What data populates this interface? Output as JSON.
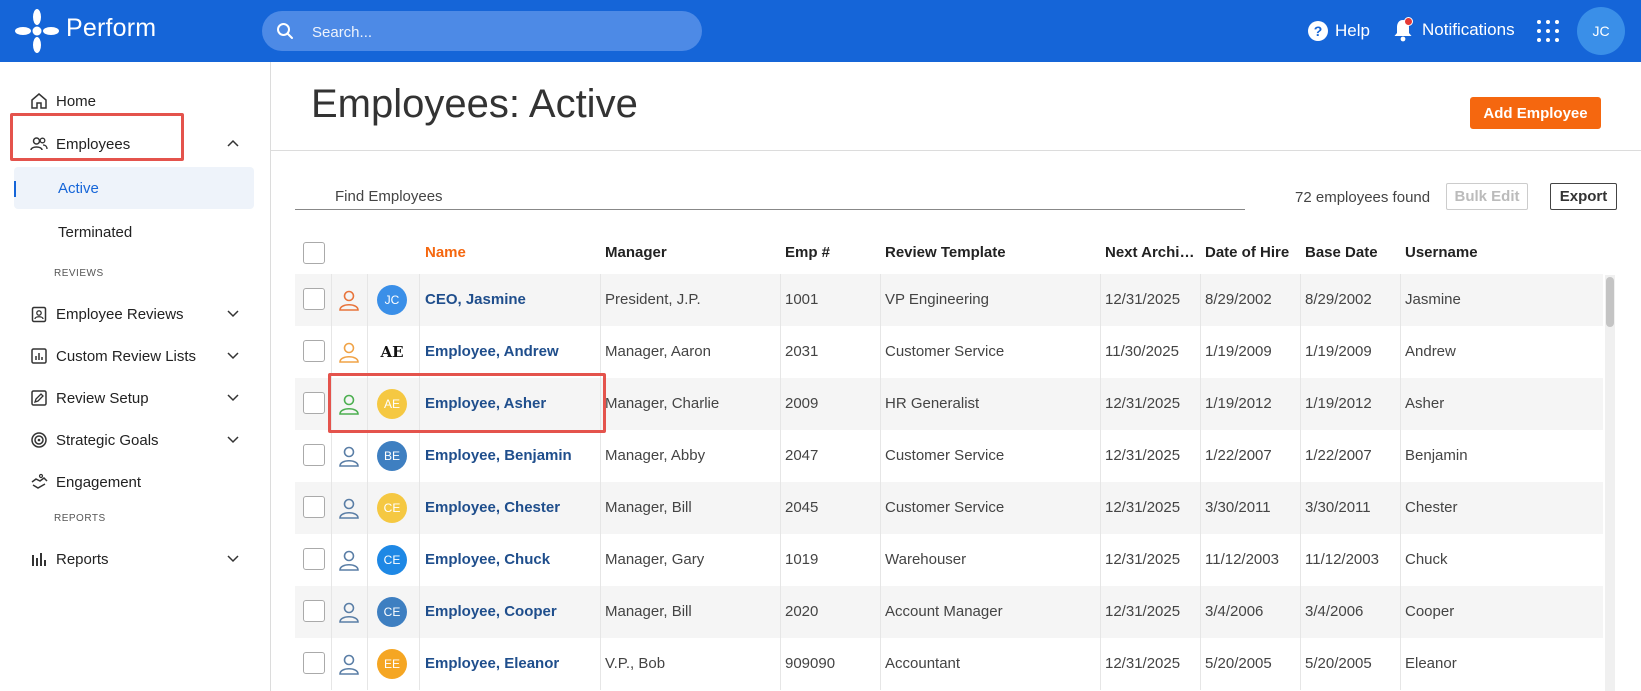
{
  "app": {
    "title": "Perform"
  },
  "header": {
    "search_placeholder": "Search...",
    "help_label": "Help",
    "notifications_label": "Notifications",
    "user_initials": "JC"
  },
  "sidebar": {
    "home": "Home",
    "employees": "Employees",
    "active": "Active",
    "terminated": "Terminated",
    "reviews_section": "REVIEWS",
    "employee_reviews": "Employee Reviews",
    "custom_review_lists": "Custom Review Lists",
    "review_setup": "Review Setup",
    "strategic_goals": "Strategic Goals",
    "engagement": "Engagement",
    "reports_section": "REPORTS",
    "reports": "Reports"
  },
  "main": {
    "title": "Employees: Active",
    "add_button": "Add Employee",
    "find_placeholder": "Find Employees",
    "count_text": "72 employees found",
    "bulk_edit": "Bulk Edit",
    "export": "Export"
  },
  "table": {
    "columns": {
      "name": "Name",
      "manager": "Manager",
      "emp": "Emp #",
      "template": "Review Template",
      "next": "Next Archi…",
      "hire": "Date of Hire",
      "base": "Base Date",
      "username": "Username"
    },
    "rows": [
      {
        "initials": "JC",
        "avatar_color": "#3a8fe8",
        "person_color": "#e8743b",
        "name": "CEO, Jasmine",
        "manager": "President, J.P.",
        "emp": "1001",
        "template": "VP Engineering",
        "next": "12/31/2025",
        "hire": "8/29/2002",
        "base": "8/29/2002",
        "username": "Jasmine"
      },
      {
        "initials": "AE",
        "avatar_color": "logo",
        "person_color": "#f0a347",
        "name": "Employee, Andrew",
        "manager": "Manager, Aaron",
        "emp": "2031",
        "template": "Customer Service",
        "next": "11/30/2025",
        "hire": "1/19/2009",
        "base": "1/19/2009",
        "username": "Andrew"
      },
      {
        "initials": "AE",
        "avatar_color": "#f5c842",
        "person_color": "#4caf50",
        "name": "Employee, Asher",
        "manager": "Manager, Charlie",
        "emp": "2009",
        "template": "HR Generalist",
        "next": "12/31/2025",
        "hire": "1/19/2012",
        "base": "1/19/2012",
        "username": "Asher"
      },
      {
        "initials": "BE",
        "avatar_color": "#3e7fc1",
        "person_color": "#5a7ea6",
        "name": "Employee, Benjamin",
        "manager": "Manager, Abby",
        "emp": "2047",
        "template": "Customer Service",
        "next": "12/31/2025",
        "hire": "1/22/2007",
        "base": "1/22/2007",
        "username": "Benjamin"
      },
      {
        "initials": "CE",
        "avatar_color": "#f5c842",
        "person_color": "#5a7ea6",
        "name": "Employee, Chester",
        "manager": "Manager, Bill",
        "emp": "2045",
        "template": "Customer Service",
        "next": "12/31/2025",
        "hire": "3/30/2011",
        "base": "3/30/2011",
        "username": "Chester"
      },
      {
        "initials": "CE",
        "avatar_color": "#1e88e5",
        "person_color": "#5a7ea6",
        "name": "Employee, Chuck",
        "manager": "Manager, Gary",
        "emp": "1019",
        "template": "Warehouser",
        "next": "12/31/2025",
        "hire": "11/12/2003",
        "base": "11/12/2003",
        "username": "Chuck"
      },
      {
        "initials": "CE",
        "avatar_color": "#3e7fc1",
        "person_color": "#5a7ea6",
        "name": "Employee, Cooper",
        "manager": "Manager, Bill",
        "emp": "2020",
        "template": "Account Manager",
        "next": "12/31/2025",
        "hire": "3/4/2006",
        "base": "3/4/2006",
        "username": "Cooper"
      },
      {
        "initials": "EE",
        "avatar_color": "#f5a623",
        "person_color": "#5a7ea6",
        "name": "Employee, Eleanor",
        "manager": "V.P., Bob",
        "emp": "909090",
        "template": "Accountant",
        "next": "12/31/2025",
        "hire": "5/20/2005",
        "base": "5/20/2005",
        "username": "Eleanor"
      }
    ]
  }
}
